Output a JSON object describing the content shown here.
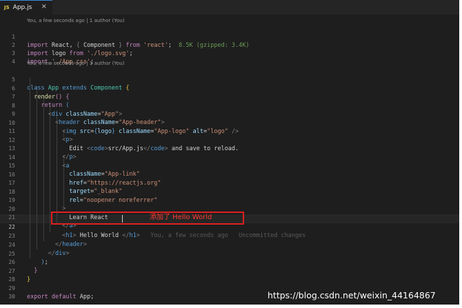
{
  "tab": {
    "icon": "JS",
    "file": "App.js",
    "close": "×"
  },
  "blame": {
    "top": "You, a few seconds ago | 1 author (You)",
    "class": "You, a few seconds ago | 1 author (You)",
    "line22": "You, a few seconds ago",
    "uncommitted": "Uncommitted changes"
  },
  "lines": {
    "n1": "1",
    "n2": "2",
    "n3": "3",
    "n4": "4",
    "n5": "5",
    "n6": "6",
    "n7": "7",
    "n8": "8",
    "n9": "9",
    "n10": "10",
    "n11": "11",
    "n12": "12",
    "n13": "13",
    "n14": "14",
    "n15": "15",
    "n16": "16",
    "n17": "17",
    "n18": "18",
    "n19": "19",
    "n20": "20",
    "n21": "21",
    "n22": "22",
    "n23": "23",
    "n24": "24",
    "n25": "25",
    "n26": "26",
    "n27": "27",
    "n28": "28",
    "n29": "29",
    "n30": "30"
  },
  "code": {
    "import": "import",
    "from": "from",
    "react_name": "React",
    "component": "Component",
    "react_str": "'react'",
    "size_info": "8.5K (gzipped: 3.4K)",
    "logo": "logo",
    "logo_str": "'./logo.svg'",
    "css_str": "'./App.css'",
    "class_kw": "class",
    "app_name": "App",
    "extends_kw": "extends",
    "render": "render",
    "return_kw": "return",
    "div": "div",
    "header": "header",
    "img": "img",
    "p": "p",
    "code_tag": "code",
    "a": "a",
    "h1": "h1",
    "classname_attr": "className",
    "src_attr": "src",
    "alt_attr": "alt",
    "href_attr": "href",
    "target_attr": "target",
    "rel_attr": "rel",
    "app_str": "\"App\"",
    "app_header_str": "\"App-header\"",
    "app_logo_str": "\"App-logo\"",
    "logo_alt_str": "\"logo\"",
    "app_link_str": "\"App-link\"",
    "href_str": "\"https://reactjs.org\"",
    "target_str": "\"_blank\"",
    "rel_str": "\"noopener noreferrer\"",
    "edit_text": "Edit ",
    "path_text": "src/App.js",
    "save_text": " and save to reload.",
    "learn_text": "Learn React",
    "hello_text": " Hello World ",
    "export_kw": "export",
    "default_kw": "default"
  },
  "annotation": "添加了 Hello World",
  "watermark": "https://blog.csdn.net/weixin_44164867"
}
